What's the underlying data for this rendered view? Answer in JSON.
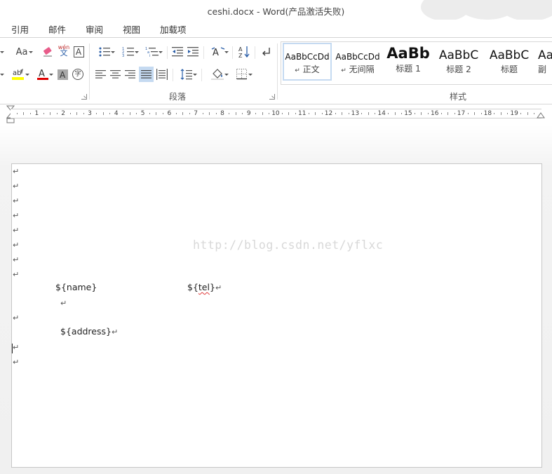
{
  "window": {
    "title": "ceshi.docx - Word(产品激活失败)"
  },
  "menu": {
    "tabs": [
      "引用",
      "邮件",
      "审阅",
      "视图",
      "加载项"
    ]
  },
  "ribbon": {
    "font_partial": {
      "aa_label": "Aa",
      "phonetic_top": "wén",
      "phonetic_bottom": "文",
      "border_char": "A",
      "enclosed_char": "字"
    },
    "groups": {
      "paragraph": "段落",
      "styles": "样式"
    },
    "styles": [
      {
        "sample": "AaBbCcDd",
        "name": "正文",
        "mark": "↵"
      },
      {
        "sample": "AaBbCcDd",
        "name": "无间隔",
        "mark": "↵"
      },
      {
        "sample": "AaBb",
        "name": "标题 1"
      },
      {
        "sample": "AaBbC",
        "name": "标题 2"
      },
      {
        "sample": "AaBbC",
        "name": "标题"
      },
      {
        "sample": "Aa",
        "name": "副"
      }
    ],
    "colors": {
      "highlight": "#ffff00",
      "font_color": "#e00000",
      "selected_fill": "#c5daf1"
    }
  },
  "ruler": {
    "numbers": [
      "1",
      "2",
      "3",
      "4",
      "5",
      "6",
      "7",
      "8",
      "9",
      "10",
      "11",
      "12",
      "13",
      "14",
      "15",
      "16",
      "17",
      "18",
      "19"
    ]
  },
  "document": {
    "watermark": "http://blog.csdn.net/yflxc",
    "paragraph_mark": "↵",
    "fields": {
      "name": "${name}",
      "tel_prefix": "${",
      "tel_word": "tel",
      "tel_suffix": "}",
      "address": "${address}"
    }
  }
}
